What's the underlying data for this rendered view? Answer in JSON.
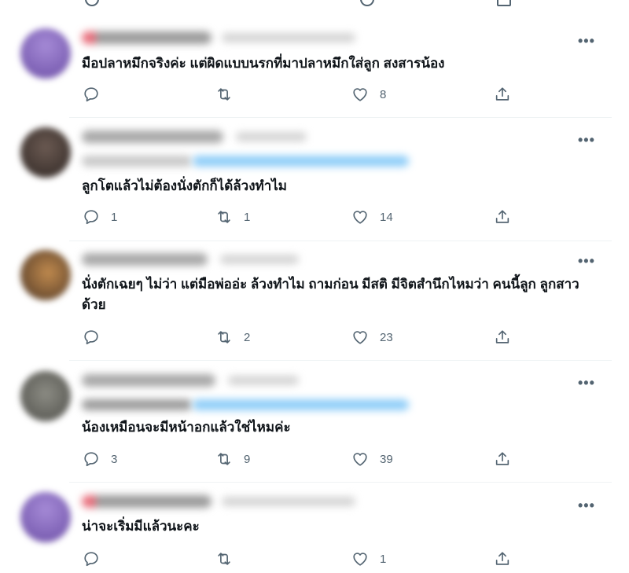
{
  "tweets": [
    {
      "text": "มือปลาหมึกจริงค่ะ แต่ผิดแบบนรกที่มาปลาหมึกใส่ลูก สงสารน้อง",
      "replies": "",
      "retweets": "",
      "likes": "8"
    },
    {
      "text": "ลูกโตแล้วไม่ต้องนั่งตักก็ได้ล้วงทำไม",
      "replies": "1",
      "retweets": "1",
      "likes": "14"
    },
    {
      "text": "นั่งตักเฉยๆ ไม่ว่า แต่มือพ่ออ่ะ ล้วงทำไม ถามก่อน มีสติ มีจิตสำนึกไหมว่า คนนี้ลูก ลูกสาวด้วย",
      "replies": "",
      "retweets": "2",
      "likes": "23"
    },
    {
      "text": "น้องเหมือนจะมีหน้าอกแล้วใช่ไหมค่ะ",
      "replies": "3",
      "retweets": "9",
      "likes": "39"
    },
    {
      "text": "น่าจะเริ่มมีแล้วนะคะ",
      "replies": "",
      "retweets": "",
      "likes": "1"
    }
  ],
  "icons": {
    "reply": "reply-icon",
    "retweet": "retweet-icon",
    "like": "heart-icon",
    "share": "share-icon",
    "more": "more-icon"
  },
  "more_label": "•••",
  "colors": {
    "text": "#0f1419",
    "muted": "#536471",
    "divider": "#eff3f4",
    "mention_blur": "#8ecdf8"
  }
}
